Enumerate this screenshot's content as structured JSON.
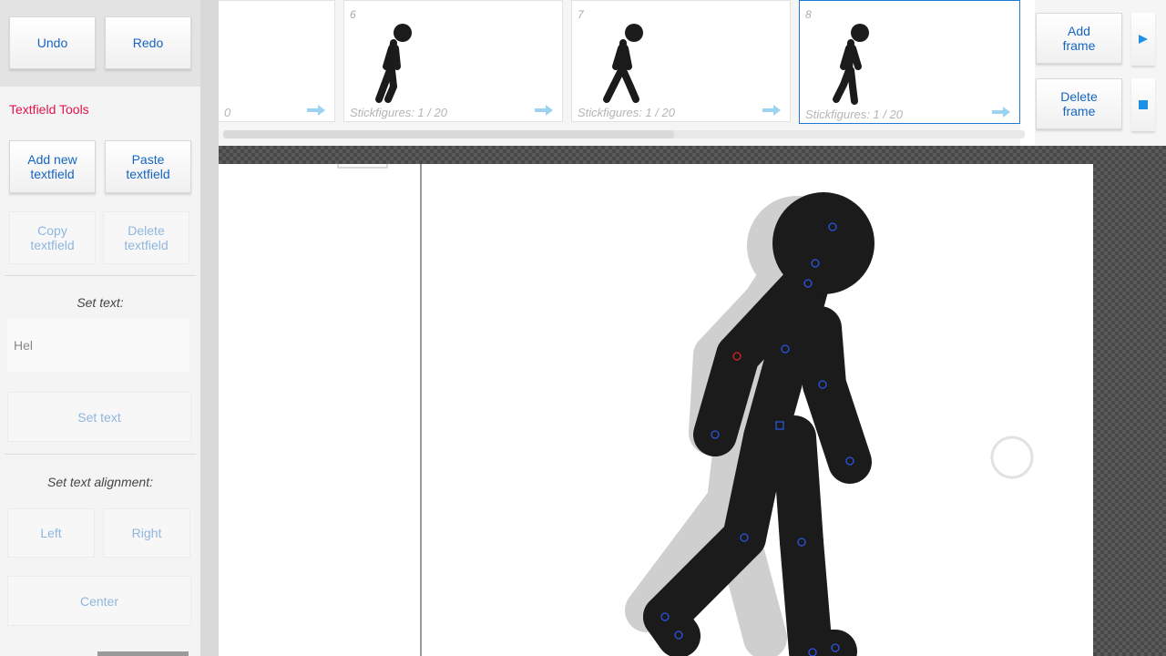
{
  "toolbar": {
    "undo": "Undo",
    "redo": "Redo"
  },
  "textfield_tools": {
    "title": "Textfield Tools",
    "add_new": "Add new textfield",
    "paste": "Paste textfield",
    "copy": "Copy textfield",
    "delete": "Delete textfield",
    "set_text_label": "Set text:",
    "text_value": "Hel",
    "set_text_button": "Set text",
    "alignment_label": "Set text alignment:",
    "align_left": "Left",
    "align_right": "Right",
    "align_center": "Center"
  },
  "timeline": {
    "frames": [
      {
        "number": "",
        "info": "0"
      },
      {
        "number": "6",
        "info": "Stickfigures: 1 / 20"
      },
      {
        "number": "7",
        "info": "Stickfigures: 1 / 20"
      },
      {
        "number": "8",
        "info": "Stickfigures: 1 / 20"
      }
    ],
    "add_frame": "Add frame",
    "delete_frame": "Delete frame"
  },
  "colors": {
    "accent": "#1565c0",
    "section_title": "#e3134d",
    "selection": "#1e78d6",
    "figure": "#1b1b1b",
    "onion_skin": "#c8c8c8"
  },
  "icons": [
    "arrow-right-icon",
    "play-icon",
    "stop-icon"
  ]
}
